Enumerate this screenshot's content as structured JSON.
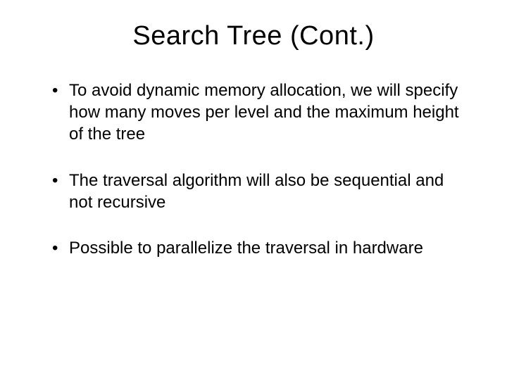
{
  "title": "Search Tree (Cont.)",
  "bullets": [
    "To avoid dynamic memory allocation, we will specify how many moves per level and the maximum height of the tree",
    "The traversal algorithm will also be sequential and not recursive",
    "Possible to parallelize the traversal in hardware"
  ]
}
